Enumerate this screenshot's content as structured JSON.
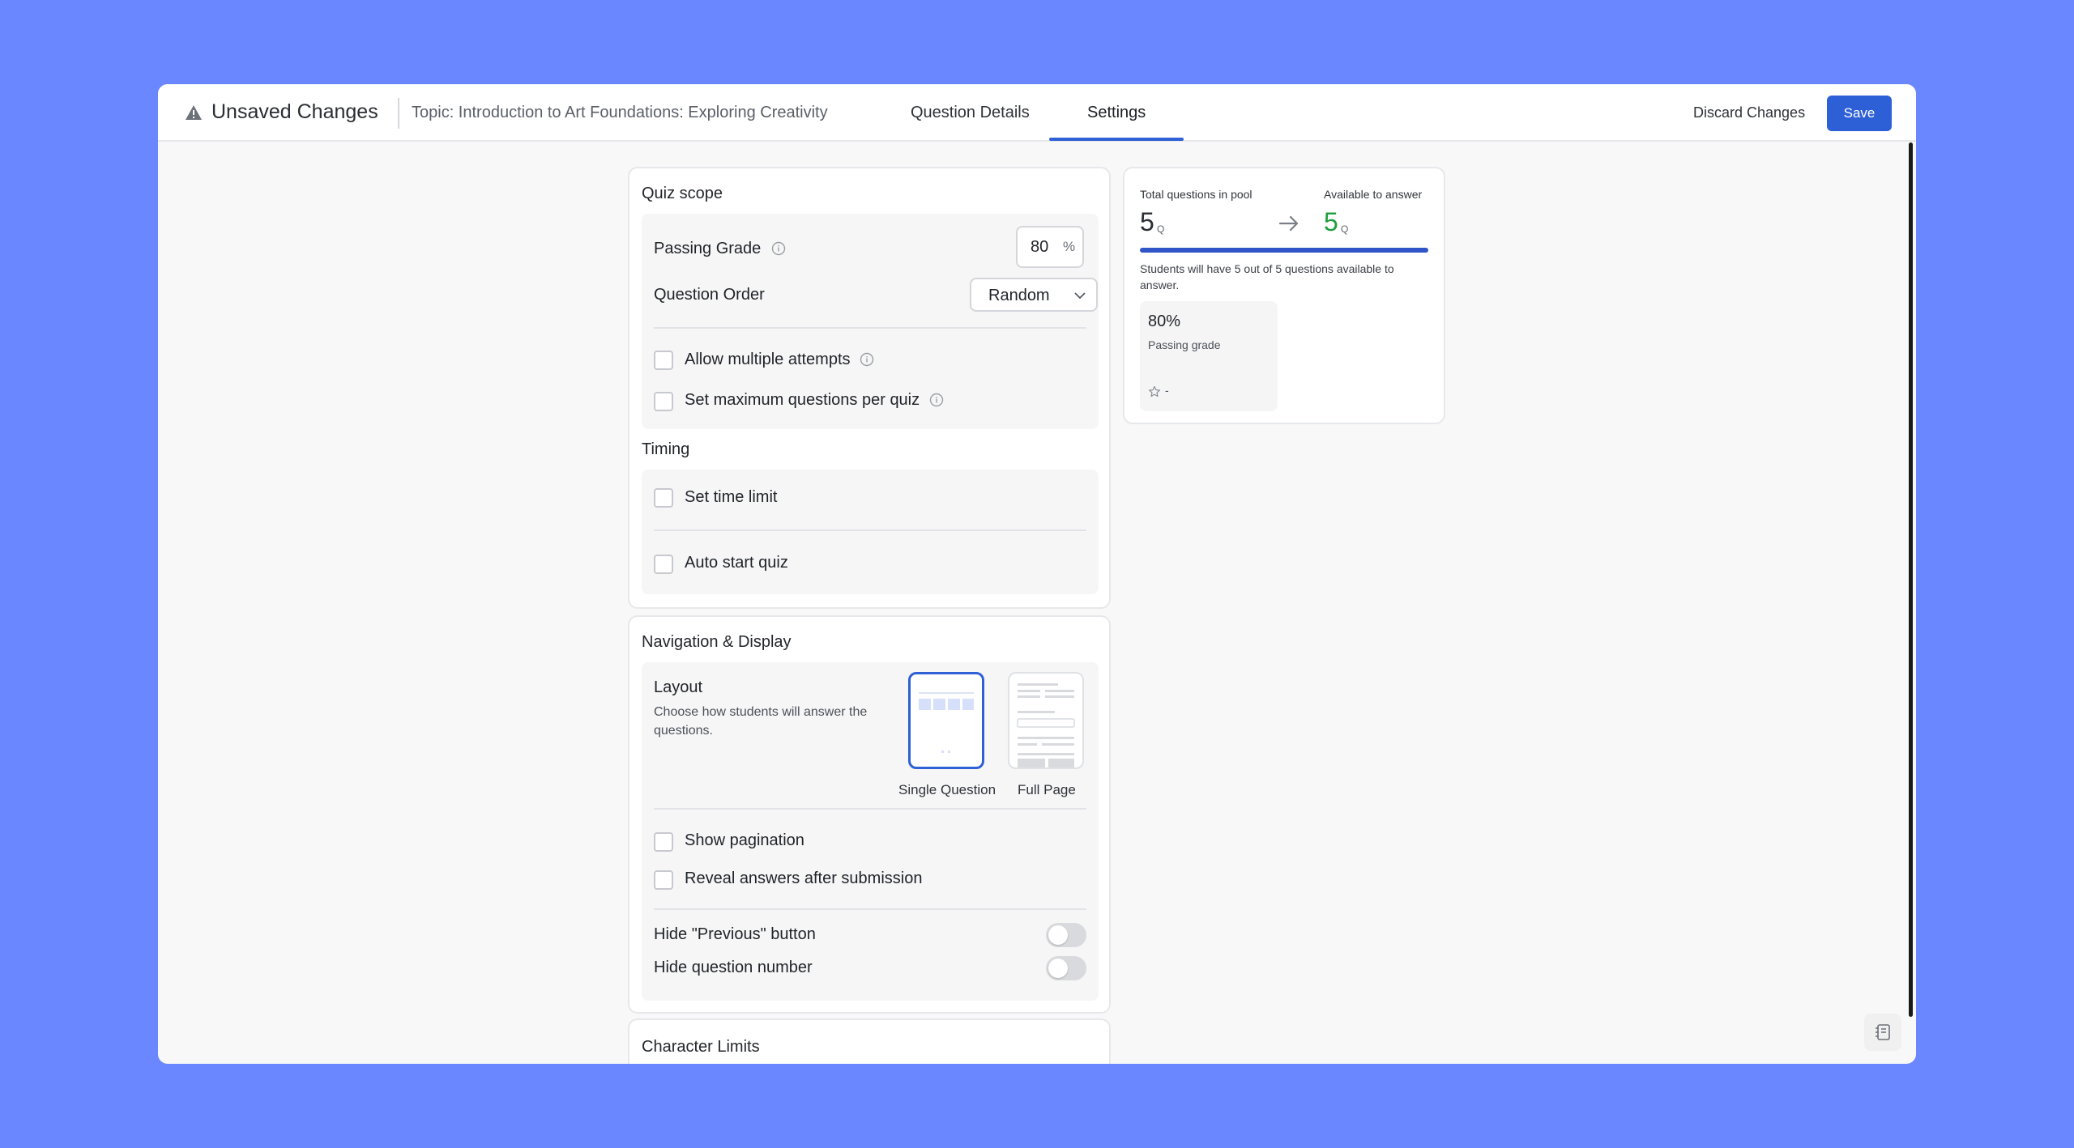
{
  "header": {
    "status_title": "Unsaved Changes",
    "topic": "Topic: Introduction to Art Foundations: Exploring Creativity",
    "tabs": [
      {
        "label": "Question Details"
      },
      {
        "label": "Settings"
      }
    ],
    "active_tab": "Settings",
    "discard_label": "Discard Changes",
    "save_label": "Save"
  },
  "quiz_scope": {
    "title": "Quiz scope",
    "passing_grade_label": "Passing Grade",
    "passing_grade_value": "80",
    "passing_grade_unit": "%",
    "question_order_label": "Question Order",
    "question_order_value": "Random",
    "allow_multiple_attempts": "Allow multiple attempts",
    "set_max_questions": "Set maximum questions per quiz"
  },
  "timing": {
    "title": "Timing",
    "set_time_limit": "Set time limit",
    "auto_start": "Auto start quiz"
  },
  "navigation": {
    "title": "Navigation & Display",
    "layout_label": "Layout",
    "layout_desc": "Choose how students will answer the questions.",
    "options": [
      {
        "label": "Single Question",
        "selected": true
      },
      {
        "label": "Full Page",
        "selected": false
      }
    ],
    "show_pagination": "Show pagination",
    "reveal_answers": "Reveal answers after submission",
    "hide_previous": "Hide \"Previous\" button",
    "hide_question_number": "Hide question number"
  },
  "character_limits": {
    "title": "Character Limits"
  },
  "stats": {
    "total_label": "Total questions in pool",
    "total_value": "5",
    "total_unit": "Q",
    "available_label": "Available to answer",
    "available_value": "5",
    "available_unit": "Q",
    "available_fraction": 1.0,
    "note": "Students will have 5 out of 5 questions available to answer.",
    "passing_pct": "80%",
    "passing_label": "Passing grade",
    "rating_value": "-"
  },
  "colors": {
    "background": "#6b87ff",
    "accent": "#2d5fd7",
    "available_green": "#1f9d3a"
  }
}
